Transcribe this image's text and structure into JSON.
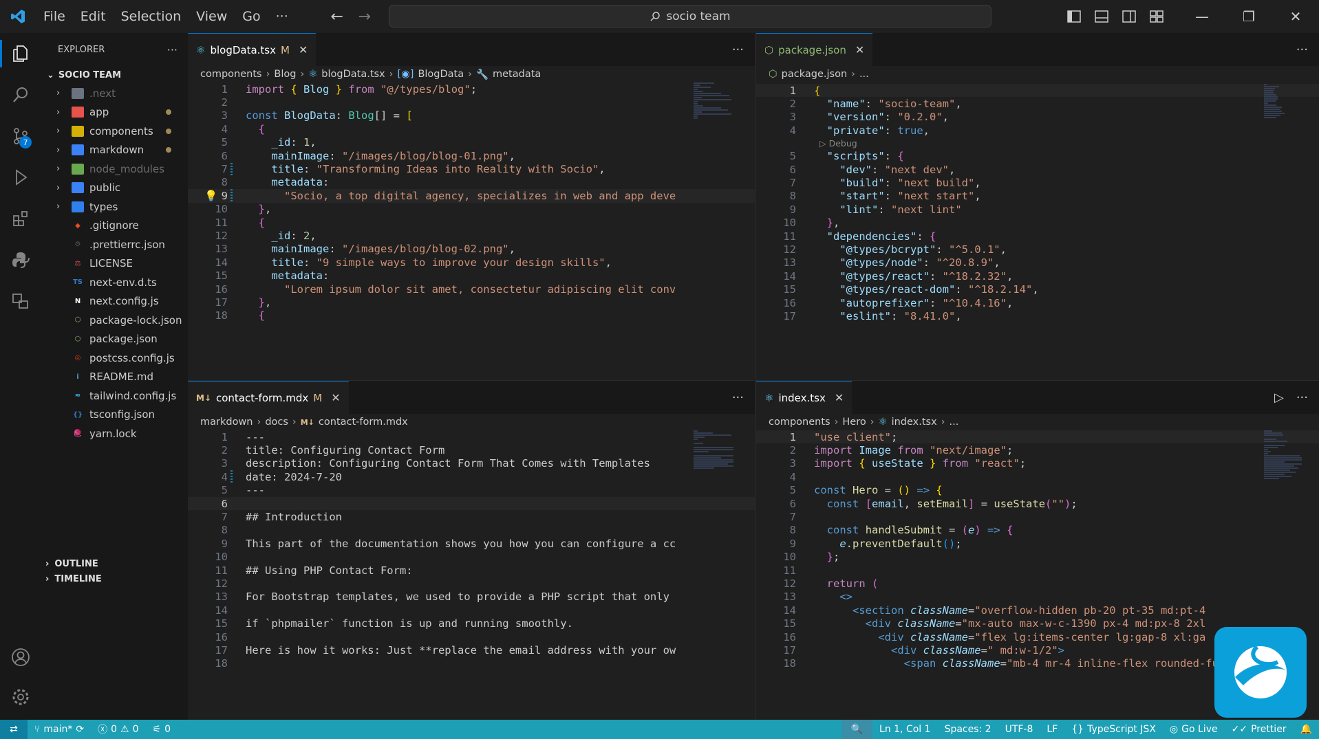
{
  "titlebar": {
    "menus": [
      "File",
      "Edit",
      "Selection",
      "View",
      "Go"
    ],
    "more": "···",
    "search_text": "socio team"
  },
  "activity": {
    "scm_badge": "7"
  },
  "sidebar": {
    "title": "EXPLORER",
    "more": "···",
    "root": "SOCIO TEAM",
    "folders": [
      {
        "name": ".next",
        "dim": true,
        "mod": false
      },
      {
        "name": "app",
        "dim": false,
        "mod": true
      },
      {
        "name": "components",
        "dim": false,
        "mod": true
      },
      {
        "name": "markdown",
        "dim": false,
        "mod": true
      },
      {
        "name": "node_modules",
        "dim": true,
        "mod": false
      },
      {
        "name": "public",
        "dim": false,
        "mod": false
      },
      {
        "name": "types",
        "dim": false,
        "mod": false
      }
    ],
    "files": [
      ".gitignore",
      ".prettierrc.json",
      "LICENSE",
      "next-env.d.ts",
      "next.config.js",
      "package-lock.json",
      "package.json",
      "postcss.config.js",
      "README.md",
      "tailwind.config.js",
      "tsconfig.json",
      "yarn.lock"
    ],
    "outline": "OUTLINE",
    "timeline": "TIMELINE"
  },
  "editor1": {
    "tab": "blogData.tsx",
    "mod": "M",
    "breadcrumb": [
      "components",
      "Blog",
      "blogData.tsx",
      "BlogData",
      "metadata"
    ],
    "lines": [
      "1",
      "2",
      "3",
      "4",
      "5",
      "6",
      "7",
      "8",
      "9",
      "10",
      "11",
      "12",
      "13",
      "14",
      "15",
      "16",
      "17",
      "18"
    ]
  },
  "editor2": {
    "tab": "package.json",
    "breadcrumb": [
      "package.json",
      "..."
    ],
    "codelens": "Debug",
    "lines": [
      "1",
      "2",
      "3",
      "4",
      "5",
      "6",
      "7",
      "8",
      "9",
      "10",
      "11",
      "12",
      "13",
      "14",
      "15",
      "16",
      "17"
    ]
  },
  "editor3": {
    "tab": "contact-form.mdx",
    "mod": "M",
    "breadcrumb": [
      "markdown",
      "docs",
      "contact-form.mdx"
    ],
    "lines": [
      "1",
      "2",
      "3",
      "4",
      "5",
      "6",
      "7",
      "8",
      "9",
      "10",
      "11",
      "12",
      "13",
      "14",
      "15",
      "16",
      "17",
      "18"
    ]
  },
  "editor4": {
    "tab": "index.tsx",
    "breadcrumb": [
      "components",
      "Hero",
      "index.tsx",
      "..."
    ],
    "lines": [
      "1",
      "2",
      "3",
      "4",
      "5",
      "6",
      "7",
      "8",
      "9",
      "10",
      "11",
      "12",
      "13",
      "14",
      "15",
      "16",
      "17",
      "18"
    ]
  },
  "statusbar": {
    "branch": "main*",
    "errors": "0",
    "warnings": "0",
    "ports": "0",
    "position": "Ln 1, Col 1",
    "spaces": "Spaces: 2",
    "encoding": "UTF-8",
    "eol": "LF",
    "language": "TypeScript JSX",
    "golive": "Go Live",
    "prettier": "Prettier"
  }
}
